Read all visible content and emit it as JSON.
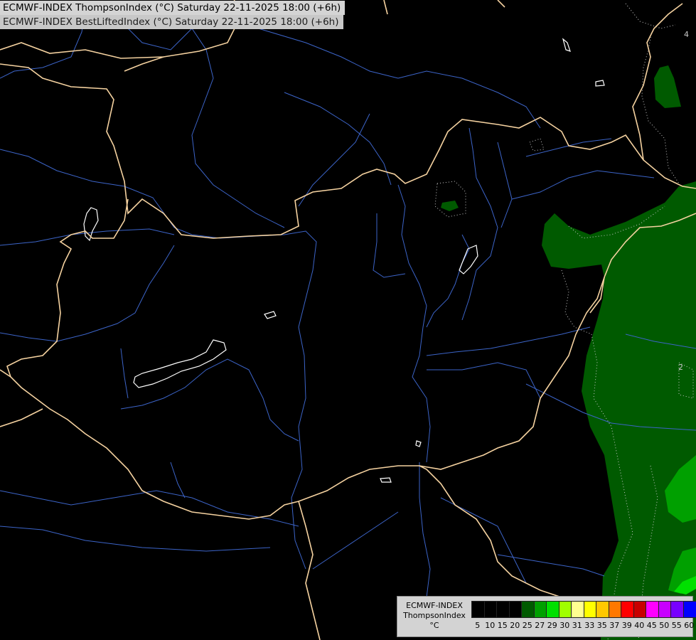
{
  "titles": {
    "line1": "ECMWF-INDEX ThompsonIndex (°C) Saturday 22-11-2025 18:00 (+6h)",
    "line2": "ECMWF-INDEX BestLiftedIndex (°C) Saturday 22-11-2025 18:00 (+6h)"
  },
  "legend": {
    "line1": "ECMWF-INDEX",
    "line2": "ThompsonIndex",
    "unit": "°C",
    "bins": [
      {
        "label": "5",
        "color": "#000000"
      },
      {
        "label": "10",
        "color": "#000000"
      },
      {
        "label": "15",
        "color": "#000000"
      },
      {
        "label": "20",
        "color": "#000000"
      },
      {
        "label": "25",
        "color": "#005a00"
      },
      {
        "label": "27",
        "color": "#00a000"
      },
      {
        "label": "29",
        "color": "#00e000"
      },
      {
        "label": "30",
        "color": "#a0ff00"
      },
      {
        "label": "31",
        "color": "#ffff90"
      },
      {
        "label": "33",
        "color": "#ffff00"
      },
      {
        "label": "35",
        "color": "#ffc800"
      },
      {
        "label": "37",
        "color": "#ff7800"
      },
      {
        "label": "39",
        "color": "#ff0000"
      },
      {
        "label": "40",
        "color": "#c80000"
      },
      {
        "label": "45",
        "color": "#ff00ff"
      },
      {
        "label": "50",
        "color": "#c800ff"
      },
      {
        "label": "55",
        "color": "#7800ff"
      },
      {
        "label": "60",
        "color": "#0000ff"
      }
    ]
  },
  "contour_labels": [
    "4",
    "2"
  ],
  "colors": {
    "border": "#f5d2a0",
    "river": "#3c64c8",
    "lake_outline": "#ffffff",
    "contour": "#c8c8c8"
  }
}
